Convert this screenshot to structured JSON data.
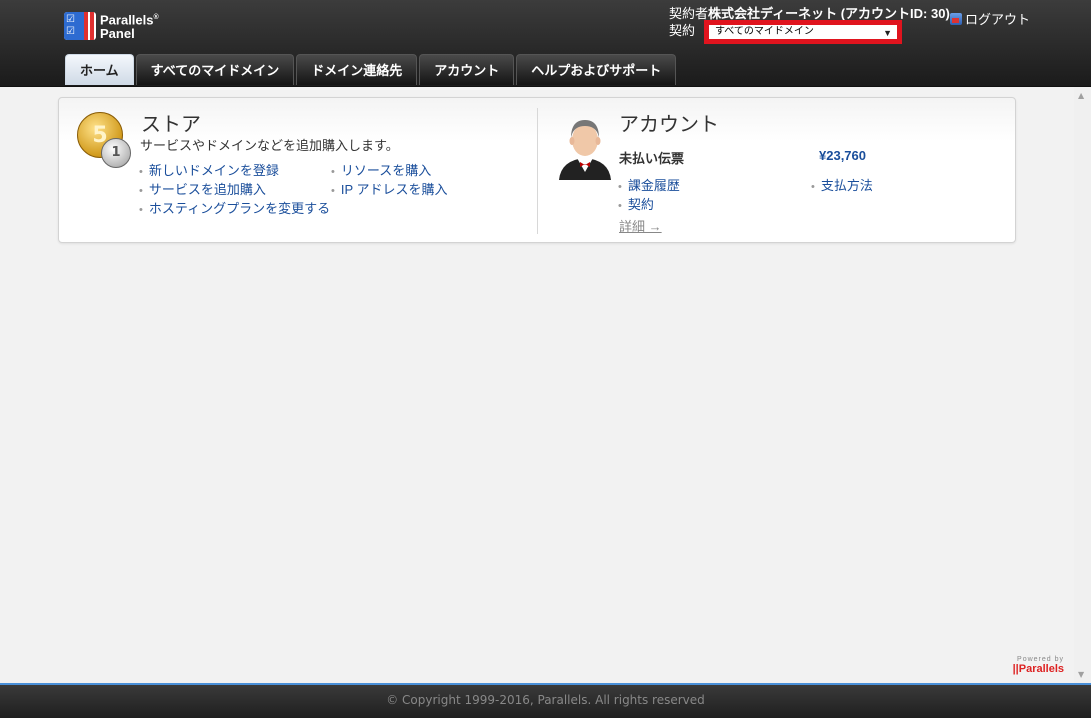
{
  "header": {
    "logo_line1": "Parallels",
    "logo_line2": "Panel",
    "account_prefix": "契約者",
    "account_name": "株式会社ディーネット (アカウントID: 30)",
    "contract_label": "契約",
    "contract_selected": "すべてのマイドメイン",
    "logout_label": "ログアウト"
  },
  "tabs": [
    {
      "label": "ホーム",
      "active": true
    },
    {
      "label": "すべてのマイドメイン"
    },
    {
      "label": "ドメイン連絡先"
    },
    {
      "label": "アカウント"
    },
    {
      "label": "ヘルプおよびサポート"
    }
  ],
  "store": {
    "title": "ストア",
    "description": "サービスやドメインなどを追加購入します。",
    "coin_gold": "5",
    "coin_silver": "1",
    "links": [
      "新しいドメインを登録",
      "リソースを購入",
      "サービスを追加購入",
      "IP アドレスを購入",
      "ホスティングプランを変更する"
    ]
  },
  "account": {
    "title": "アカウント",
    "unpaid_label": "未払い伝票",
    "unpaid_amount": "¥23,760",
    "links": [
      "課金履歴",
      "支払方法",
      "契約"
    ],
    "details": "詳細 →"
  },
  "powered": {
    "by": "Powered by",
    "name": "Parallels"
  },
  "footer": {
    "copyright": "© Copyright 1999-2016, Parallels. All rights reserved"
  },
  "colors": {
    "accent_red": "#e0141e",
    "link_blue": "#1a4e9b",
    "header_dark": "#1b1b1b"
  }
}
